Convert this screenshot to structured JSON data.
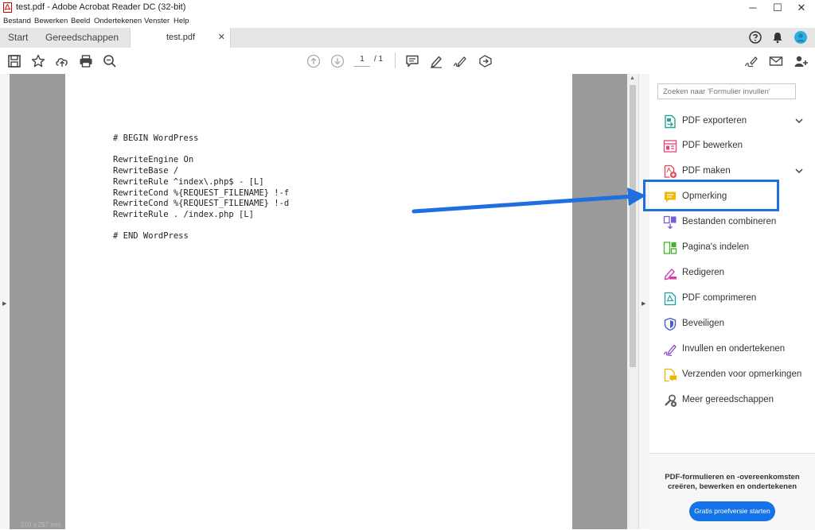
{
  "window": {
    "title": "test.pdf - Adobe Acrobat Reader DC (32-bit)",
    "minimize": "─",
    "maximize": "☐",
    "close": "✕"
  },
  "menu": {
    "items": [
      "Bestand",
      "Bewerken",
      "Beeld",
      "Ondertekenen",
      "Venster",
      "Help"
    ]
  },
  "tabs": {
    "home": "Start",
    "tools": "Gereedschappen",
    "document": "test.pdf",
    "close_glyph": "✕"
  },
  "toolbar": {
    "page_current": "1",
    "page_total": "/ 1"
  },
  "document": {
    "lines": [
      "# BEGIN WordPress",
      "",
      "RewriteEngine On",
      "RewriteBase /",
      "RewriteRule ^index\\.php$ - [L]",
      "RewriteCond %{REQUEST_FILENAME} !-f",
      "RewriteCond %{REQUEST_FILENAME} !-d",
      "RewriteRule . /index.php [L]",
      "",
      "# END WordPress"
    ],
    "size_label": "210 x 297 mm"
  },
  "panel": {
    "search_placeholder": "Zoeken naar 'Formulier invullen'",
    "tools": [
      {
        "label": "PDF exporteren",
        "icon": "export-pdf-icon",
        "color": "#2aa29a",
        "expand": true
      },
      {
        "label": "PDF bewerken",
        "icon": "edit-pdf-icon",
        "color": "#e0457b",
        "expand": false
      },
      {
        "label": "PDF maken",
        "icon": "create-pdf-icon",
        "color": "#e34850",
        "expand": true
      },
      {
        "label": "Opmerking",
        "icon": "comment-icon",
        "color": "#f0b800",
        "expand": false
      },
      {
        "label": "Bestanden combineren",
        "icon": "combine-files-icon",
        "color": "#7a5cd6",
        "expand": false
      },
      {
        "label": "Pagina's indelen",
        "icon": "organize-pages-icon",
        "color": "#45b02a",
        "expand": false
      },
      {
        "label": "Redigeren",
        "icon": "redact-icon",
        "color": "#d33bb0",
        "expand": false
      },
      {
        "label": "PDF comprimeren",
        "icon": "compress-pdf-icon",
        "color": "#1fa0a8",
        "expand": false
      },
      {
        "label": "Beveiligen",
        "icon": "protect-icon",
        "color": "#4a5fc9",
        "expand": false
      },
      {
        "label": "Invullen en ondertekenen",
        "icon": "fill-sign-icon",
        "color": "#8e44c9",
        "expand": false
      },
      {
        "label": "Verzenden voor opmerkingen",
        "icon": "send-for-comments-icon",
        "color": "#e8b800",
        "expand": false
      },
      {
        "label": "Meer gereedschappen",
        "icon": "more-tools-icon",
        "color": "#555555",
        "expand": false
      }
    ],
    "promo_text": "PDF-formulieren en -overeenkomsten creëren, bewerken en ondertekenen",
    "promo_button": "Gratis proefversie starten"
  },
  "colors": {
    "accent": "#1473e6",
    "highlight": "#1f6fe0"
  }
}
